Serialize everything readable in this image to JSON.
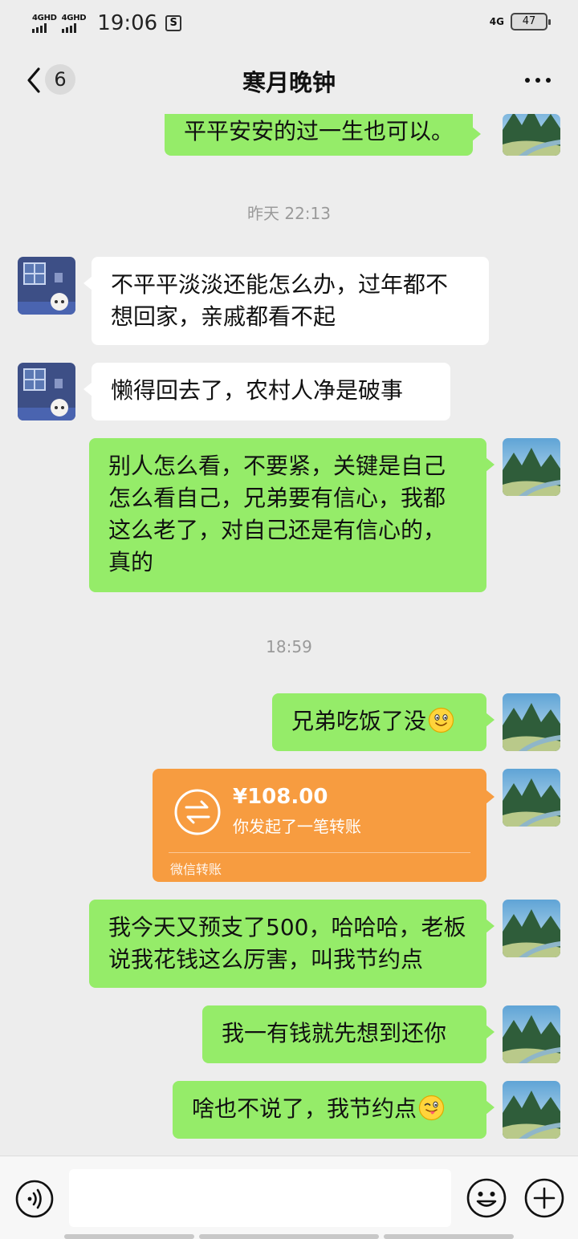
{
  "status_bar": {
    "sim1": "4GHD",
    "sim2": "4GHD",
    "time": "19:06",
    "app_icon": "S",
    "network": "4G",
    "battery": "47"
  },
  "header": {
    "unread_count": "6",
    "title": "寒月晚钟",
    "back_icon": "chevron-left-icon",
    "more_icon": "more-dots-icon"
  },
  "messages": [
    {
      "type": "text",
      "from": "me",
      "text": "平平安安的过一生也可以。"
    },
    {
      "type": "time",
      "text": "昨天 22:13"
    },
    {
      "type": "text",
      "from": "them",
      "text": "不平平淡淡还能怎么办，过年都不想回家，亲戚都看不起"
    },
    {
      "type": "text",
      "from": "them",
      "text": "懒得回去了，农村人净是破事"
    },
    {
      "type": "text",
      "from": "me",
      "text": "别人怎么看，不要紧，关键是自己怎么看自己，兄弟要有信心，我都这么老了，对自己还是有信心的，真的"
    },
    {
      "type": "time",
      "text": "18:59"
    },
    {
      "type": "text",
      "from": "me",
      "text": "兄弟吃饭了没",
      "emoji": "smile-emoji"
    },
    {
      "type": "transfer",
      "from": "me",
      "amount": "¥108.00",
      "desc": "你发起了一笔转账",
      "label": "微信转账"
    },
    {
      "type": "text",
      "from": "me",
      "text": "我今天又预支了500，哈哈哈，老板说我花钱这么厉害，叫我节约点"
    },
    {
      "type": "text",
      "from": "me",
      "text": "我一有钱就先想到还你"
    },
    {
      "type": "text",
      "from": "me",
      "text": "啥也不说了，我节约点",
      "emoji": "wink-tongue-emoji"
    }
  ],
  "input_bar": {
    "voice_icon": "voice-icon",
    "emoji_icon": "emoji-icon",
    "plus_icon": "plus-icon",
    "input_value": ""
  },
  "colors": {
    "background": "#ededed",
    "my_bubble": "#95ec69",
    "their_bubble": "#ffffff",
    "transfer_card": "#f79c40"
  }
}
